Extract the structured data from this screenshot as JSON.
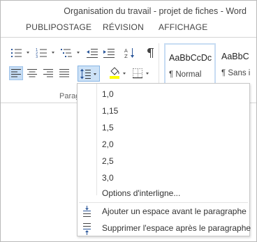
{
  "window": {
    "title": "Organisation du travail - projet de fiches - Word"
  },
  "tabs": [
    {
      "label": "PUBLIPOSTAGE"
    },
    {
      "label": "RÉVISION"
    },
    {
      "label": "AFFICHAGE"
    }
  ],
  "ribbon": {
    "group_label": "Paragraphe",
    "selected_button": "line-spacing",
    "highlight_color": "#ffff00",
    "accent_color": "#2b579a",
    "styles": [
      {
        "preview": "AaBbCcDc",
        "name": "¶ Normal",
        "active": true
      },
      {
        "preview": "AaBbC",
        "name": "¶ Sans i",
        "active": false
      }
    ]
  },
  "menu": {
    "spacing_options": [
      {
        "label": "1,0"
      },
      {
        "label": "1,15"
      },
      {
        "label": "1,5"
      },
      {
        "label": "2,0"
      },
      {
        "label": "2,5"
      },
      {
        "label": "3,0"
      }
    ],
    "options_label": "Options d'interligne...",
    "add_space_label": "Ajouter un espace avant le paragraphe",
    "remove_space_label": "Supprimer l'espace après le paragraphe"
  }
}
